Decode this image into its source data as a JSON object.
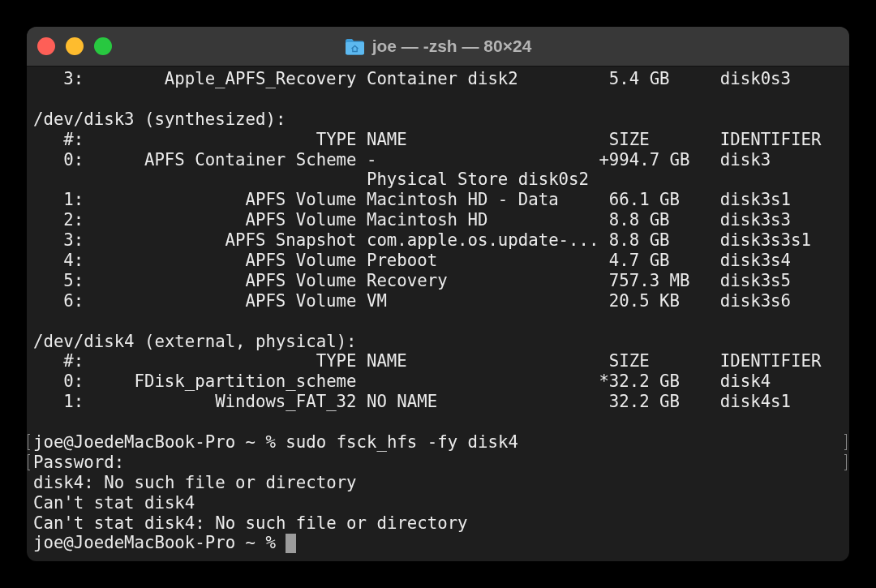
{
  "window": {
    "title": "joe — -zsh — 80×24"
  },
  "terminal": {
    "lines": [
      {
        "kind": "row",
        "index": "3:",
        "type": "Apple_APFS_Recovery",
        "name": "Container disk2",
        "size": "5.4 GB",
        "signed": false,
        "identifier": "disk0s3"
      },
      {
        "kind": "blank"
      },
      {
        "kind": "text",
        "text": "/dev/disk3 (synthesized):",
        "marked": false,
        "cursor": false
      },
      {
        "kind": "header",
        "index": "#:",
        "type": "TYPE",
        "name": "NAME",
        "size": "SIZE",
        "signed": false,
        "identifier": "IDENTIFIER"
      },
      {
        "kind": "row",
        "index": "0:",
        "type": "APFS Container Scheme",
        "name": "-",
        "size": "+994.7 GB",
        "signed": true,
        "identifier": "disk3"
      },
      {
        "kind": "row",
        "name": "Physical Store disk0s2"
      },
      {
        "kind": "row",
        "index": "1:",
        "type": "APFS Volume",
        "name": "Macintosh HD - Data",
        "size": "66.1 GB",
        "signed": false,
        "identifier": "disk3s1"
      },
      {
        "kind": "row",
        "index": "2:",
        "type": "APFS Volume",
        "name": "Macintosh HD",
        "size": "8.8 GB",
        "signed": false,
        "identifier": "disk3s3"
      },
      {
        "kind": "row",
        "index": "3:",
        "type": "APFS Snapshot",
        "name": "com.apple.os.update-...",
        "size": "8.8 GB",
        "signed": false,
        "identifier": "disk3s3s1"
      },
      {
        "kind": "row",
        "index": "4:",
        "type": "APFS Volume",
        "name": "Preboot",
        "size": "4.7 GB",
        "signed": false,
        "identifier": "disk3s4"
      },
      {
        "kind": "row",
        "index": "5:",
        "type": "APFS Volume",
        "name": "Recovery",
        "size": "757.3 MB",
        "signed": false,
        "identifier": "disk3s5"
      },
      {
        "kind": "row",
        "index": "6:",
        "type": "APFS Volume",
        "name": "VM",
        "size": "20.5 KB",
        "signed": false,
        "identifier": "disk3s6"
      },
      {
        "kind": "blank"
      },
      {
        "kind": "text",
        "text": "/dev/disk4 (external, physical):",
        "marked": false,
        "cursor": false
      },
      {
        "kind": "header",
        "index": "#:",
        "type": "TYPE",
        "name": "NAME",
        "size": "SIZE",
        "signed": false,
        "identifier": "IDENTIFIER"
      },
      {
        "kind": "row",
        "index": "0:",
        "type": "FDisk_partition_scheme",
        "size": "*32.2 GB",
        "signed": true,
        "identifier": "disk4"
      },
      {
        "kind": "row",
        "index": "1:",
        "type": "Windows_FAT_32",
        "name": "NO NAME",
        "size": "32.2 GB",
        "signed": false,
        "identifier": "disk4s1"
      },
      {
        "kind": "blank"
      },
      {
        "kind": "prompt",
        "text": "joe@JoedeMacBook-Pro ~ % sudo fsck_hfs -fy disk4",
        "marked": true,
        "cursor": false
      },
      {
        "kind": "text",
        "text": "Password:",
        "marked": true,
        "cursor": false
      },
      {
        "kind": "text",
        "text": "disk4: No such file or directory",
        "marked": false,
        "cursor": false
      },
      {
        "kind": "text",
        "text": "Can't stat disk4",
        "marked": false,
        "cursor": false
      },
      {
        "kind": "text",
        "text": "Can't stat disk4: No such file or directory",
        "marked": false,
        "cursor": false
      },
      {
        "kind": "prompt",
        "text": "joe@JoedeMacBook-Pro ~ %",
        "marked": false,
        "cursor": true
      }
    ]
  }
}
